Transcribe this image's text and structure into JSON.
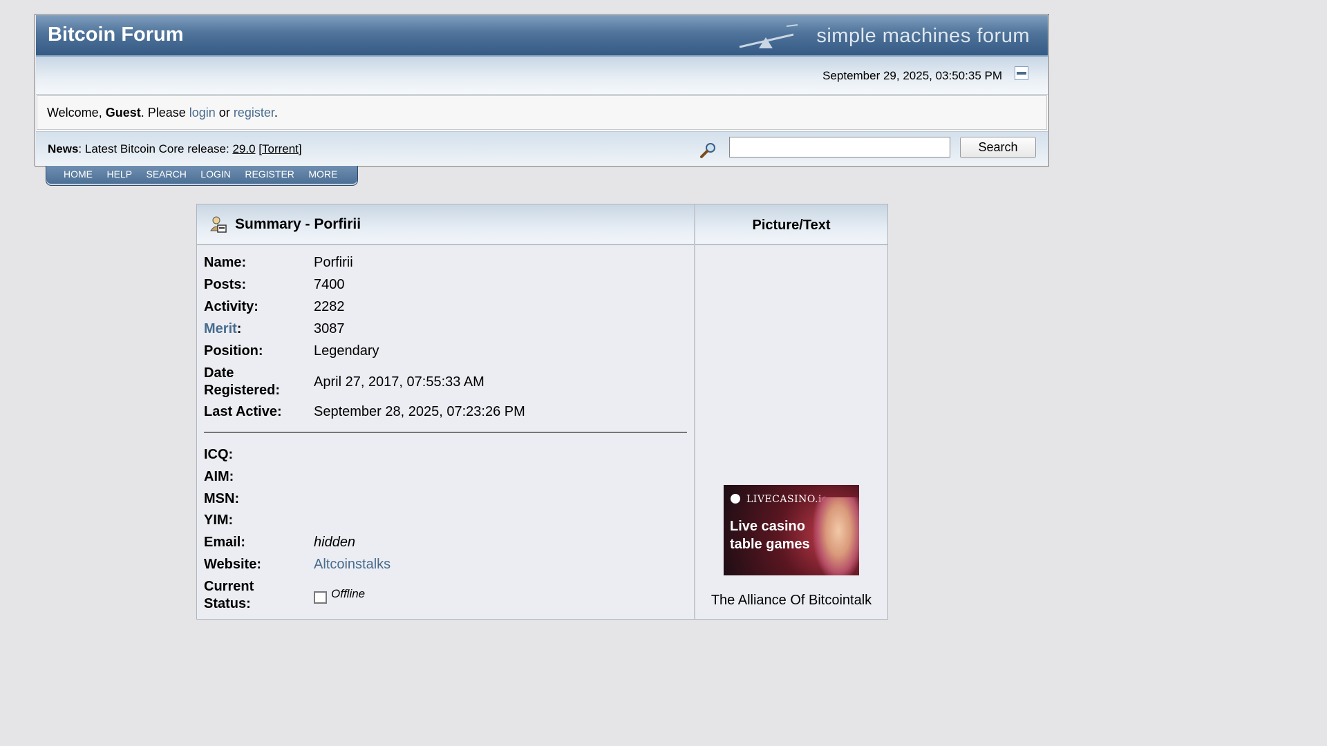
{
  "header": {
    "forum_title": "Bitcoin Forum",
    "logo_text": "simple machines forum",
    "datetime": "September 29, 2025, 03:50:35 PM"
  },
  "welcome": {
    "prefix": "Welcome, ",
    "user": "Guest",
    "middle": ". Please ",
    "login": "login",
    "or": " or ",
    "register": "register",
    "suffix": "."
  },
  "news": {
    "label": "News",
    "text": ": Latest Bitcoin Core release: ",
    "version": "29.0",
    "space": " [",
    "torrent": "Torrent",
    "close": "]"
  },
  "search": {
    "placeholder": "",
    "button_label": "Search"
  },
  "nav": {
    "items": [
      "HOME",
      "HELP",
      "SEARCH",
      "LOGIN",
      "REGISTER",
      "MORE"
    ]
  },
  "profile": {
    "summary_title": "Summary - Porfirii",
    "picture_title": "Picture/Text",
    "fields": {
      "name_label": "Name:",
      "name": "Porfirii",
      "posts_label": "Posts:",
      "posts": "7400",
      "activity_label": "Activity:",
      "activity": "2282",
      "merit_label": "Merit",
      "merit_colon": ":",
      "merit": "3087",
      "position_label": "Position:",
      "position": "Legendary",
      "date_registered_label_1": "Date",
      "date_registered_label_2": "Registered:",
      "date_registered": "April 27, 2017, 07:55:33 AM",
      "last_active_label": "Last Active:",
      "last_active": "September 28, 2025, 07:23:26 PM",
      "icq_label": "ICQ:",
      "aim_label": "AIM:",
      "msn_label": "MSN:",
      "yim_label": "YIM:",
      "email_label": "Email:",
      "email": "hidden",
      "website_label": "Website:",
      "website": "Altcoinstalks",
      "status_label_1": "Current",
      "status_label_2": "Status:",
      "status": "Offline"
    },
    "ad": {
      "brand": "LIVECASINO.io",
      "line1": "Live casino",
      "line2": "table games"
    },
    "personal_text": "The Alliance Of Bitcointalk"
  },
  "colors": {
    "title_bar": "#476c8e",
    "link": "#476c8e",
    "page_bg": "#e5e5e8"
  }
}
